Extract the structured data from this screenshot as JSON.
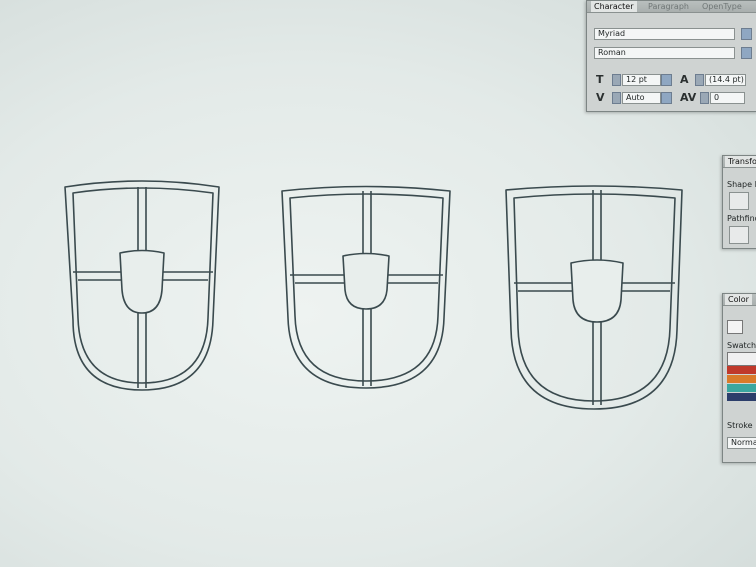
{
  "character_panel": {
    "tabs": [
      "Character",
      "Paragraph",
      "OpenType"
    ],
    "font_family": "Myriad",
    "font_style": "Roman",
    "font_size": "12 pt",
    "leading": "(14.4 pt)",
    "kerning": "Auto",
    "tracking": "0"
  },
  "transform_panel": {
    "tab": "Transform",
    "shape_modes_label": "Shape M",
    "pathfinder_label": "Pathfind"
  },
  "color_panel": {
    "tab": "Color",
    "swatches_label": "Swatch",
    "stroke_label": "Stroke",
    "blend_mode": "Norma",
    "swatch_colors": [
      "#c0392b",
      "#d97a2a",
      "#3aa7a0",
      "#2c3e6b"
    ]
  },
  "icons": [
    "font-size-icon",
    "leading-icon",
    "kerning-icon",
    "tracking-icon",
    "shape-mode-icon",
    "pathfinder-icon",
    "fill-stroke-icon",
    "swatch-grid-icon"
  ],
  "artwork": {
    "shield_count": 3
  }
}
